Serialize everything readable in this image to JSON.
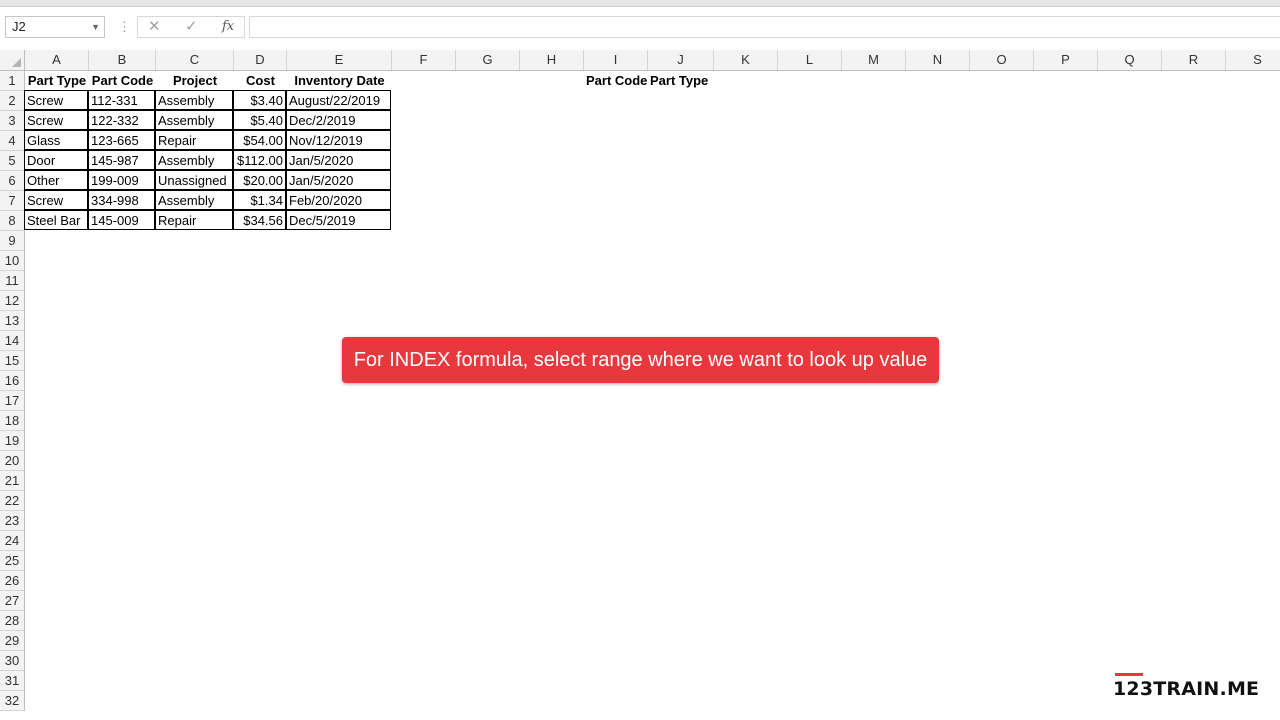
{
  "formula_bar": {
    "name_box": "J2",
    "cancel_icon": "✕",
    "enter_icon": "✓",
    "function_icon": "fx",
    "formula": ""
  },
  "columns": [
    "A",
    "B",
    "C",
    "D",
    "E",
    "F",
    "G",
    "H",
    "I",
    "J",
    "K",
    "L",
    "M",
    "N",
    "O",
    "P",
    "Q",
    "R",
    "S"
  ],
  "rows": [
    "1",
    "2",
    "3",
    "4",
    "5",
    "6",
    "7",
    "8",
    "9",
    "10",
    "11",
    "12",
    "13",
    "14",
    "15",
    "16",
    "17",
    "18",
    "19",
    "20",
    "21",
    "22",
    "23",
    "24",
    "25",
    "26",
    "27",
    "28",
    "29",
    "30",
    "31",
    "32"
  ],
  "table": {
    "headers": [
      "Part Type",
      "Part Code",
      "Project",
      "Cost",
      "Inventory Date"
    ],
    "rows": [
      [
        "Screw",
        "112-331",
        "Assembly",
        "$3.40",
        "August/22/2019"
      ],
      [
        "Screw",
        "122-332",
        "Assembly",
        "$5.40",
        "Dec/2/2019"
      ],
      [
        "Glass",
        "123-665",
        "Repair",
        "$54.00",
        "Nov/12/2019"
      ],
      [
        "Door",
        "145-987",
        "Assembly",
        "$112.00",
        "Jan/5/2020"
      ],
      [
        "Other",
        "199-009",
        "Unassigned",
        "$20.00",
        "Jan/5/2020"
      ],
      [
        "Screw",
        "334-998",
        "Assembly",
        "$1.34",
        "Feb/20/2020"
      ],
      [
        "Steel Bar",
        "145-009",
        "Repair",
        "$34.56",
        "Dec/5/2019"
      ]
    ]
  },
  "lookup_headers": {
    "part_code": "Part Code",
    "part_type": "Part Type"
  },
  "callout": "For INDEX formula, select range where we want to look up value",
  "logo": "123TRAIN.ME",
  "colors": {
    "callout": "#e8383e",
    "logo_accent": "#e8383e"
  }
}
